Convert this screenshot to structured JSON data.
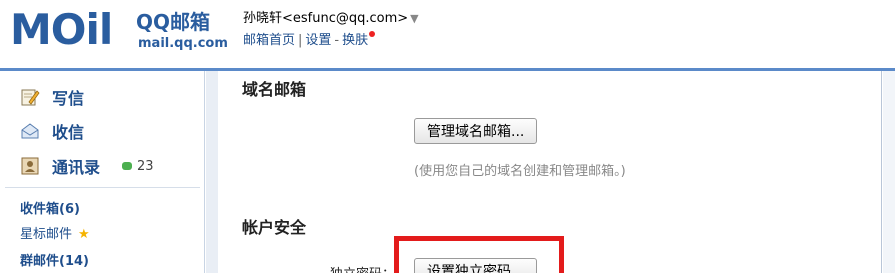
{
  "logo": {
    "mark": "MOil",
    "product": "QQ邮箱",
    "url": "mail.qq.com"
  },
  "user": {
    "display": "孙晓轩<esfunc@qq.com>",
    "caret": "▼",
    "links": [
      "邮箱首页",
      "设置",
      "换肤"
    ],
    "separator": "|",
    "separator2": "-"
  },
  "sidebar": {
    "nav": [
      {
        "label": "写信",
        "icon": "pencil-icon"
      },
      {
        "label": "收信",
        "icon": "inbox-icon"
      },
      {
        "label": "通讯录",
        "icon": "contacts-icon",
        "badge": "23"
      }
    ],
    "folders": [
      {
        "label": "收件箱(6)"
      },
      {
        "label": "星标邮件",
        "icon": "star-icon",
        "star": "★"
      },
      {
        "label": "群邮件(14)"
      }
    ]
  },
  "main": {
    "domain_section": {
      "title": "域名邮箱",
      "button": "管理域名邮箱...",
      "hint": "(使用您自己的域名创建和管理邮箱。)"
    },
    "security_section": {
      "title": "帐户安全",
      "field_label": "独立密码：",
      "button": "设置独立密码..."
    }
  },
  "colors": {
    "brand": "#2a5d9f",
    "link": "#1f4e8c",
    "highlight": "#e31b1b"
  }
}
